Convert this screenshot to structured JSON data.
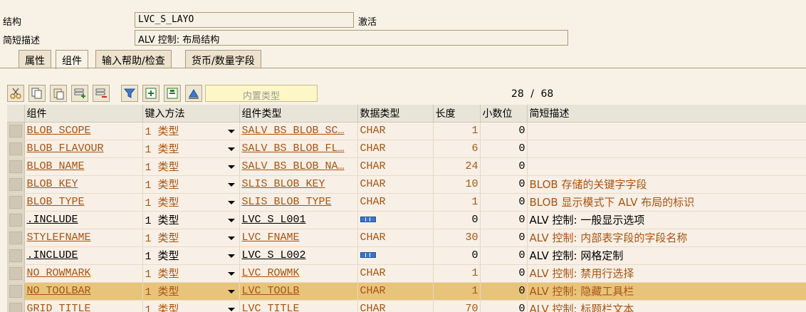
{
  "header": {
    "structure_label": "结构",
    "structure_value": "LVC_S_LAYO",
    "status": "激活",
    "short_desc_label": "简短描述",
    "short_desc_value": "ALV 控制: 布局结构"
  },
  "tabs": [
    "属性",
    "组件",
    "输入帮助/检查",
    "货币/数量字段"
  ],
  "active_tab": "组件",
  "toolbar": {
    "search_placeholder": "内置类型",
    "counter_current": "28",
    "counter_sep": "/",
    "counter_total": "68"
  },
  "columns": [
    "组件",
    "键入方法",
    "组件类型",
    "数据类型",
    "长度",
    "小数位",
    "简短描述"
  ],
  "rows": [
    {
      "component": "BLOB_SCOPE",
      "entry": "1 类型",
      "comp_type": "SALV_BS_BLOB_SC…",
      "data_type": "CHAR",
      "length": "1",
      "decimals": "0",
      "desc": ""
    },
    {
      "component": "BLOB_FLAVOUR",
      "entry": "1 类型",
      "comp_type": "SALV_BS_BLOB_FL…",
      "data_type": "CHAR",
      "length": "6",
      "decimals": "0",
      "desc": ""
    },
    {
      "component": "BLOB_NAME",
      "entry": "1 类型",
      "comp_type": "SALV_BS_BLOB_NA…",
      "data_type": "CHAR",
      "length": "24",
      "decimals": "0",
      "desc": ""
    },
    {
      "component": "BLOB_KEY",
      "entry": "1 类型",
      "comp_type": "SLIS_BLOB_KEY",
      "data_type": "CHAR",
      "length": "10",
      "decimals": "0",
      "desc": "BLOB 存储的关键字字段"
    },
    {
      "component": "BLOB_TYPE",
      "entry": "1 类型",
      "comp_type": "SLIS_BLOB_TYPE",
      "data_type": "CHAR",
      "length": "1",
      "decimals": "0",
      "desc": "BLOB 显示模式下 ALV 布局的标识"
    },
    {
      "component": ".INCLUDE",
      "entry": "1 类型",
      "comp_type": "LVC_S_L001",
      "data_type": "",
      "length": "0",
      "decimals": "0",
      "desc": "ALV 控制: 一般显示选项"
    },
    {
      "component": "STYLEFNAME",
      "entry": "1 类型",
      "comp_type": "LVC_FNAME",
      "data_type": "CHAR",
      "length": "30",
      "decimals": "0",
      "desc": "ALV 控制: 内部表字段的字段名称"
    },
    {
      "component": ".INCLUDE",
      "entry": "1 类型",
      "comp_type": "LVC_S_L002",
      "data_type": "",
      "length": "0",
      "decimals": "0",
      "desc": "ALV 控制: 网格定制"
    },
    {
      "component": "NO_ROWMARK",
      "entry": "1 类型",
      "comp_type": "LVC_ROWMK",
      "data_type": "CHAR",
      "length": "1",
      "decimals": "0",
      "desc": "ALV 控制: 禁用行选择"
    },
    {
      "component": "NO_TOOLBAR",
      "entry": "1 类型",
      "comp_type": "LVC_TOOLB",
      "data_type": "CHAR",
      "length": "1",
      "decimals": "0",
      "desc": "ALV 控制: 隐藏工具栏"
    },
    {
      "component": "GRID_TITLE",
      "entry": "1 类型",
      "comp_type": "LVC_TITLE",
      "data_type": "CHAR",
      "length": "70",
      "decimals": "0",
      "desc": "ALV 控制: 标题栏文本"
    }
  ]
}
